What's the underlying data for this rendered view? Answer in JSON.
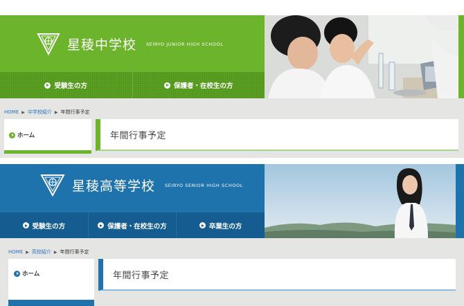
{
  "junior": {
    "name_ja": "星稜中学校",
    "name_en": "SEIRYO JUNIOR HIGH SCHOOL",
    "nav": [
      {
        "label": "受験生の方"
      },
      {
        "label": "保護者・在校生の方"
      }
    ],
    "breadcrumb": {
      "home": "HOME",
      "section": "中学校紹介",
      "current": "年間行事予定"
    },
    "sidebar": {
      "home": "ホーム"
    },
    "page_title": "年間行事予定",
    "colors": {
      "brand": "#6cb42c",
      "nav": "#5aa021"
    }
  },
  "senior": {
    "name_ja": "星稜高等学校",
    "name_en": "SEIRYO SENIOR HIGH SCHOOL",
    "nav": [
      {
        "label": "受験生の方"
      },
      {
        "label": "保護者・在校生の方"
      },
      {
        "label": "卒業生の方"
      }
    ],
    "breadcrumb": {
      "home": "HOME",
      "section": "高校紹介",
      "current": "年間行事予定"
    },
    "sidebar": {
      "home": "ホーム"
    },
    "page_title": "年間行事予定",
    "colors": {
      "brand": "#1f73ad",
      "nav": "#155d91"
    }
  }
}
